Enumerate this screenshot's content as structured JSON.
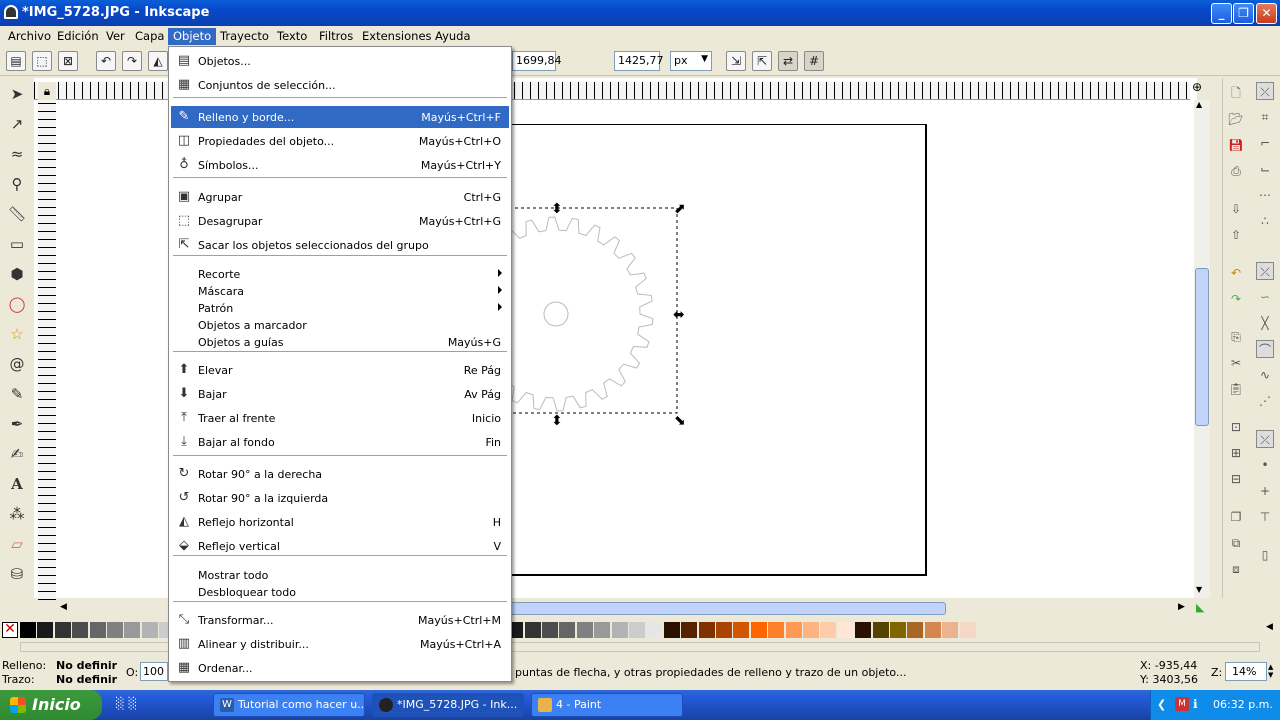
{
  "window": {
    "title": "*IMG_5728.JPG - Inkscape",
    "minimize": "_",
    "maximize": "❐",
    "close": "✕"
  },
  "menubar": [
    "Archivo",
    "Edición",
    "Ver",
    "Capa",
    "Objeto",
    "Trayecto",
    "Texto",
    "Filtros",
    "Extensiones",
    "Ayuda"
  ],
  "toolbar": {
    "w_value": "1699,84",
    "h_label": "H:",
    "h_value": "1425,77",
    "unit": "px"
  },
  "menu": {
    "items": [
      {
        "label": "Objetos...",
        "shortcut": "",
        "icon": "objects-icon"
      },
      {
        "label": "Conjuntos de selección...",
        "shortcut": "",
        "icon": "selection-sets-icon"
      },
      {
        "label": "Relleno y borde...",
        "shortcut": "Mayús+Ctrl+F",
        "icon": "fill-stroke-icon",
        "highlight": true
      },
      {
        "label": "Propiedades del objeto...",
        "shortcut": "Mayús+Ctrl+O",
        "icon": "object-properties-icon"
      },
      {
        "label": "Símbolos...",
        "shortcut": "Mayús+Ctrl+Y",
        "icon": "symbols-icon"
      },
      {
        "label": "Agrupar",
        "shortcut": "Ctrl+G",
        "icon": "group-icon"
      },
      {
        "label": "Desagrupar",
        "shortcut": "Mayús+Ctrl+G",
        "icon": "ungroup-icon"
      },
      {
        "label": "Sacar los objetos seleccionados del grupo",
        "shortcut": "",
        "icon": "pop-out-icon"
      },
      {
        "label": "Recorte",
        "shortcut": "",
        "submenu": true
      },
      {
        "label": "Máscara",
        "shortcut": "",
        "submenu": true
      },
      {
        "label": "Patrón",
        "shortcut": "",
        "submenu": true
      },
      {
        "label": "Objetos a marcador",
        "shortcut": ""
      },
      {
        "label": "Objetos a guías",
        "shortcut": "Mayús+G"
      },
      {
        "label": "Elevar",
        "shortcut": "Re Pág",
        "icon": "raise-icon"
      },
      {
        "label": "Bajar",
        "shortcut": "Av Pág",
        "icon": "lower-icon"
      },
      {
        "label": "Traer al frente",
        "shortcut": "Inicio",
        "icon": "raise-to-top-icon"
      },
      {
        "label": "Bajar al fondo",
        "shortcut": "Fin",
        "icon": "lower-to-bottom-icon"
      },
      {
        "label": "Rotar 90° a la derecha",
        "shortcut": "",
        "icon": "rotate-right-icon"
      },
      {
        "label": "Rotar 90° a la izquierda",
        "shortcut": "",
        "icon": "rotate-left-icon"
      },
      {
        "label": "Reflejo horizontal",
        "shortcut": "H",
        "icon": "flip-horizontal-icon"
      },
      {
        "label": "Reflejo vertical",
        "shortcut": "V",
        "icon": "flip-vertical-icon"
      },
      {
        "label": "Mostrar todo",
        "shortcut": ""
      },
      {
        "label": "Desbloquear todo",
        "shortcut": ""
      },
      {
        "label": "Transformar...",
        "shortcut": "Mayús+Ctrl+M",
        "icon": "transform-icon"
      },
      {
        "label": "Alinear y distribuir...",
        "shortcut": "Mayús+Ctrl+A",
        "icon": "align-icon"
      },
      {
        "label": "Ordenar...",
        "shortcut": "",
        "icon": "arrange-icon"
      }
    ]
  },
  "statusbar": {
    "fill_label": "Relleno:",
    "fill_value": "No definir",
    "stroke_label": "Trazo:",
    "stroke_value": "No definir",
    "opacity_label": "O:",
    "opacity_value": "100",
    "message": "puntas de flecha, y otras propiedades de relleno y trazo de un objeto...",
    "coord_x": "X: -935,44",
    "coord_y": "Y: 3403,56",
    "zoom_label": "Z:",
    "zoom_value": "14%"
  },
  "taskbar": {
    "start": "Inicio",
    "tasks": [
      "Tutorial como hacer u...",
      "*IMG_5728.JPG - Ink...",
      "4 - Paint"
    ],
    "clock": "06:32 p.m."
  },
  "palette": [
    "#000000",
    "#1a1a1a",
    "#333333",
    "#4d4d4d",
    "#666666",
    "#808080",
    "#999999",
    "#b3b3b3",
    "#cccccc",
    "#800000",
    "#a00000",
    "#c00000",
    "#e00000",
    "#ff0000",
    "#ff3333",
    "#ff6666",
    "#ff9999",
    "#ffcccc",
    "#2b0000",
    "#550000",
    "#800000",
    "#aa0000",
    "#d40000",
    "#ff2a2a",
    "#ff5555",
    "#ff8080",
    "#ffaaaa",
    "#ffd5d5",
    "#1a1a1a",
    "#333333",
    "#4d4d4d",
    "#666666",
    "#808080",
    "#999999",
    "#b3b3b3",
    "#cccccc",
    "#e6e6e6",
    "#2b1100",
    "#552200",
    "#803300",
    "#aa4400",
    "#d45500",
    "#ff6600",
    "#ff7f2a",
    "#ff9955",
    "#ffb380",
    "#ffccaa",
    "#ffe6d5",
    "#2b1100",
    "#554400",
    "#806600",
    "#aa6622",
    "#d4874e",
    "#e9b48e",
    "#f4d7c4"
  ]
}
